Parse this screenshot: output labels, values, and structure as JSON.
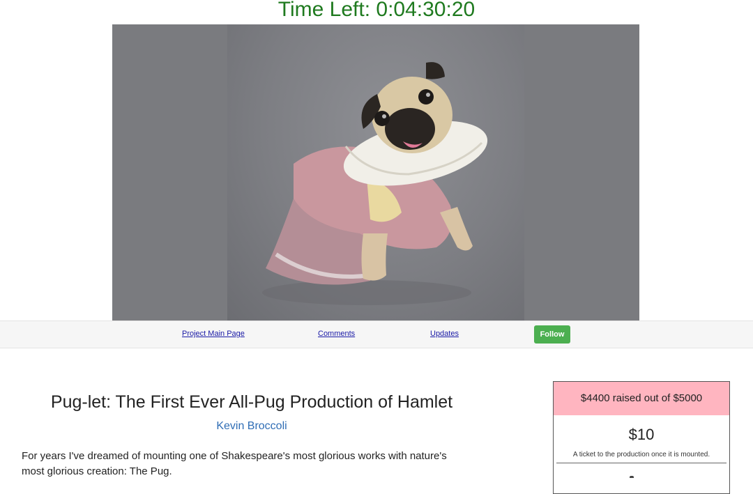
{
  "timer": {
    "text": "Time Left: 0:04:30:20"
  },
  "hero": {
    "image_subject": "pug-in-costume-photo"
  },
  "nav": {
    "links": [
      "Project Main Page",
      "Comments",
      "Updates"
    ],
    "follow_label": "Follow"
  },
  "project": {
    "title": "Pug-let: The First Ever All-Pug Production of Hamlet",
    "author": "Kevin Broccoli",
    "description_line1": "For years I've dreamed of mounting one of Shakespeare's most glorious works with nature's",
    "description_line2": "most glorious creation:  The Pug."
  },
  "funding": {
    "summary": "$4400 raised out of $5000",
    "raised": 4400,
    "goal": 5000,
    "header_color": "#ffb5c0",
    "rewards": [
      {
        "amount": "$10",
        "description": "A ticket to the production once it is mounted."
      }
    ]
  },
  "colors": {
    "timer": "#1f7a1f",
    "author_link": "#2f6db5",
    "follow_button": "#4caf50",
    "nav_link": "#1a1aa6"
  }
}
